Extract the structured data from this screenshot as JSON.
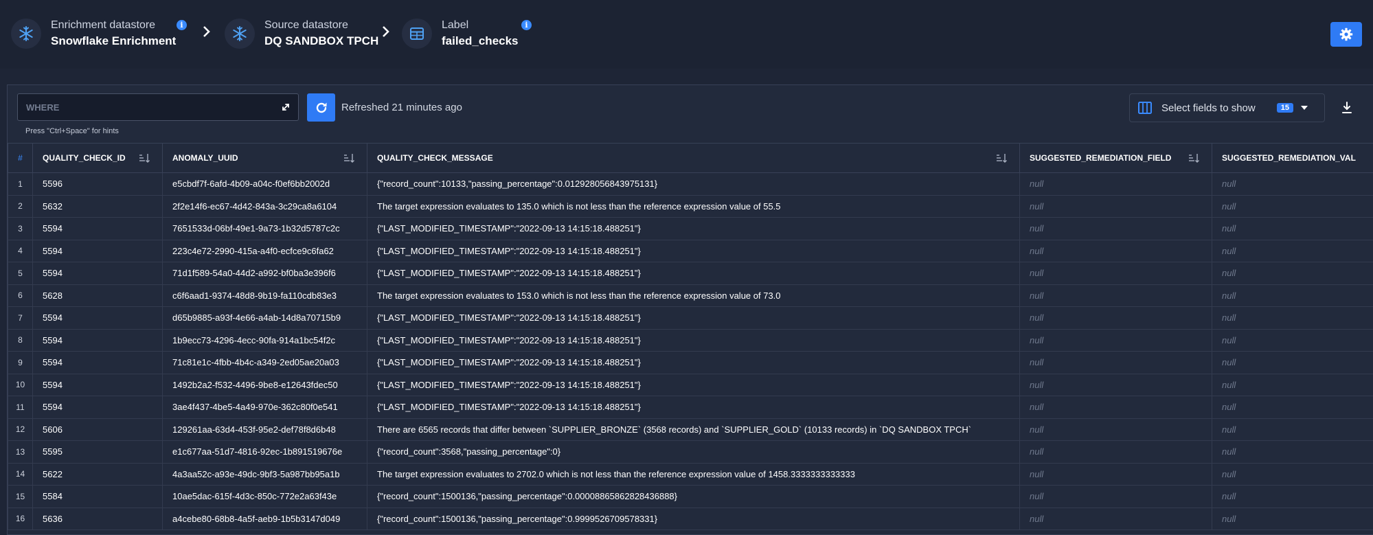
{
  "breadcrumb": [
    {
      "label": "Enrichment datastore",
      "value": "Snowflake Enrichment",
      "icon": "snowflake-icon"
    },
    {
      "label": "Source datastore",
      "value": "DQ SANDBOX TPCH",
      "icon": "snowflake-icon"
    },
    {
      "label": "Label",
      "value": "failed_checks",
      "icon": "table-icon"
    }
  ],
  "toolbar": {
    "where_placeholder": "WHERE",
    "hint": "Press \"Ctrl+Space\" for hints",
    "refreshed": "Refreshed 21 minutes ago",
    "select_fields": "Select fields to show",
    "field_count": "15"
  },
  "colors": {
    "accent": "#2f7bf5",
    "background": "#1e2536",
    "header": "#1c2333"
  },
  "table": {
    "columns": [
      "#",
      "QUALITY_CHECK_ID",
      "ANOMALY_UUID",
      "QUALITY_CHECK_MESSAGE",
      "SUGGESTED_REMEDIATION_FIELD",
      "SUGGESTED_REMEDIATION_VAL"
    ],
    "rows": [
      [
        "1",
        "5596",
        "e5cbdf7f-6afd-4b09-a04c-f0ef6bb2002d",
        "{\"record_count\":10133,\"passing_percentage\":0.012928056843975131}",
        "null",
        "null"
      ],
      [
        "2",
        "5632",
        "2f2e14f6-ec67-4d42-843a-3c29ca8a6104",
        "The target expression evaluates to 135.0 which is not less than the reference expression value of 55.5",
        "null",
        "null"
      ],
      [
        "3",
        "5594",
        "7651533d-06bf-49e1-9a73-1b32d5787c2c",
        "{\"LAST_MODIFIED_TIMESTAMP\":\"2022-09-13 14:15:18.488251\"}",
        "null",
        "null"
      ],
      [
        "4",
        "5594",
        "223c4e72-2990-415a-a4f0-ecfce9c6fa62",
        "{\"LAST_MODIFIED_TIMESTAMP\":\"2022-09-13 14:15:18.488251\"}",
        "null",
        "null"
      ],
      [
        "5",
        "5594",
        "71d1f589-54a0-44d2-a992-bf0ba3e396f6",
        "{\"LAST_MODIFIED_TIMESTAMP\":\"2022-09-13 14:15:18.488251\"}",
        "null",
        "null"
      ],
      [
        "6",
        "5628",
        "c6f6aad1-9374-48d8-9b19-fa110cdb83e3",
        "The target expression evaluates to 153.0 which is not less than the reference expression value of 73.0",
        "null",
        "null"
      ],
      [
        "7",
        "5594",
        "d65b9885-a93f-4e66-a4ab-14d8a70715b9",
        "{\"LAST_MODIFIED_TIMESTAMP\":\"2022-09-13 14:15:18.488251\"}",
        "null",
        "null"
      ],
      [
        "8",
        "5594",
        "1b9ecc73-4296-4ecc-90fa-914a1bc54f2c",
        "{\"LAST_MODIFIED_TIMESTAMP\":\"2022-09-13 14:15:18.488251\"}",
        "null",
        "null"
      ],
      [
        "9",
        "5594",
        "71c81e1c-4fbb-4b4c-a349-2ed05ae20a03",
        "{\"LAST_MODIFIED_TIMESTAMP\":\"2022-09-13 14:15:18.488251\"}",
        "null",
        "null"
      ],
      [
        "10",
        "5594",
        "1492b2a2-f532-4496-9be8-e12643fdec50",
        "{\"LAST_MODIFIED_TIMESTAMP\":\"2022-09-13 14:15:18.488251\"}",
        "null",
        "null"
      ],
      [
        "11",
        "5594",
        "3ae4f437-4be5-4a49-970e-362c80f0e541",
        "{\"LAST_MODIFIED_TIMESTAMP\":\"2022-09-13 14:15:18.488251\"}",
        "null",
        "null"
      ],
      [
        "12",
        "5606",
        "129261aa-63d4-453f-95e2-def78f8d6b48",
        "There are 6565 records that differ between `SUPPLIER_BRONZE` (3568 records) and `SUPPLIER_GOLD` (10133 records) in `DQ SANDBOX TPCH`",
        "null",
        "null"
      ],
      [
        "13",
        "5595",
        "e1c677aa-51d7-4816-92ec-1b891519676e",
        "{\"record_count\":3568,\"passing_percentage\":0}",
        "null",
        "null"
      ],
      [
        "14",
        "5622",
        "4a3aa52c-a93e-49dc-9bf3-5a987bb95a1b",
        "The target expression evaluates to 2702.0 which is not less than the reference expression value of 1458.3333333333333",
        "null",
        "null"
      ],
      [
        "15",
        "5584",
        "10ae5dac-615f-4d3c-850c-772e2a63f43e",
        "{\"record_count\":1500136,\"passing_percentage\":0.00008865862828436888}",
        "null",
        "null"
      ],
      [
        "16",
        "5636",
        "a4cebe80-68b8-4a5f-aeb9-1b5b3147d049",
        "{\"record_count\":1500136,\"passing_percentage\":0.9999526709578331}",
        "null",
        "null"
      ]
    ]
  }
}
